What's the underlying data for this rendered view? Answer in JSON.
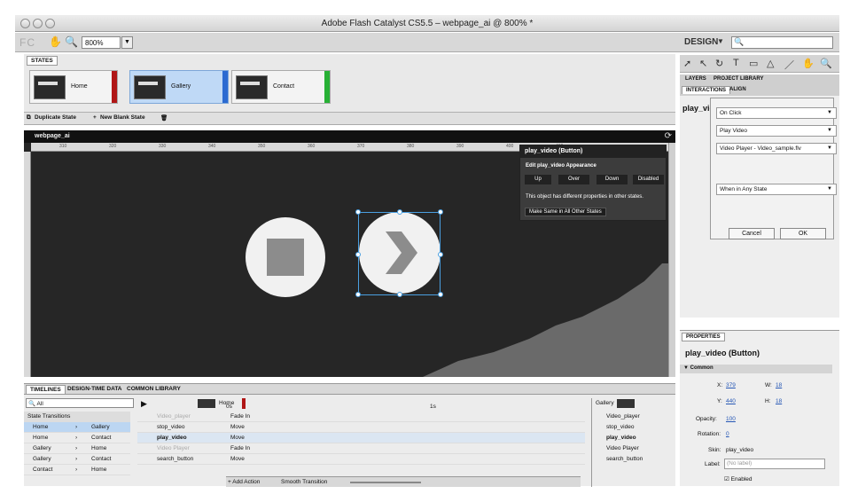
{
  "window": {
    "title": "Adobe Flash Catalyst CS5.5 – webpage_ai @ 800% *"
  },
  "appbar": {
    "logo": "FC",
    "zoom": "800%",
    "workspace": "DESIGN"
  },
  "states": {
    "tab_label": "STATES",
    "items": [
      {
        "label": "Home",
        "color": "#b01616"
      },
      {
        "label": "Gallery",
        "color": "#2b6ad1"
      },
      {
        "label": "Contact",
        "color": "#27b035"
      }
    ],
    "duplicate_label": "Duplicate State",
    "new_blank_label": "New Blank State"
  },
  "canvas": {
    "doc_name": "webpage_ai",
    "ruler_ticks": [
      "310",
      "320",
      "330",
      "340",
      "350",
      "360",
      "370",
      "380",
      "390",
      "400",
      "410"
    ]
  },
  "popup": {
    "title": "play_video (Button)",
    "subtitle": "Edit play_video Appearance",
    "buttons": [
      "Up",
      "Over",
      "Down",
      "Disabled"
    ],
    "note": "This object has different properties in other states.",
    "make_same": "Make Same in All Other States"
  },
  "timelines": {
    "tabs": [
      "TIMELINES",
      "DESIGN-TIME DATA",
      "COMMON LIBRARY"
    ],
    "filter": "All",
    "section": "State Transitions",
    "transitions": [
      {
        "from": "Home",
        "to": "Gallery"
      },
      {
        "from": "Home",
        "to": "Contact"
      },
      {
        "from": "Gallery",
        "to": "Home"
      },
      {
        "from": "Gallery",
        "to": "Contact"
      },
      {
        "from": "Contact",
        "to": "Home"
      }
    ],
    "from_state": "Home",
    "to_state": "Gallery",
    "time_0": "0s",
    "time_1": "1s",
    "objects": [
      "Video_player",
      "stop_video",
      "play_video",
      "Video Player",
      "search_button"
    ],
    "actions": [
      "Fade In",
      "Move",
      "Move",
      "Fade In",
      "Move"
    ],
    "add_action": "Add Action",
    "smooth_transition": "Smooth Transition"
  },
  "right": {
    "layers_tabs": [
      "LAYERS",
      "PROJECT LIBRARY"
    ],
    "inter_tabs": [
      "INTERACTIONS",
      "ALIGN"
    ],
    "interaction_name": "play_vic",
    "dd_event": "On Click",
    "dd_action": "Play Video",
    "dd_target": "Video Player - Video_sample.flv",
    "dd_state": "When in Any State",
    "cancel": "Cancel",
    "ok": "OK"
  },
  "props": {
    "tab": "PROPERTIES",
    "title": "play_video (Button)",
    "section": "Common",
    "x_label": "X:",
    "x": "379",
    "w_label": "W:",
    "w": "18",
    "y_label": "Y:",
    "y": "440",
    "h_label": "H:",
    "h": "18",
    "opacity_label": "Opacity:",
    "opacity": "100",
    "rotation_label": "Rotation:",
    "rotation": "0",
    "skin_label": "Skin:",
    "skin": "play_video",
    "label_label": "Label:",
    "label_placeholder": "(No label)",
    "enabled": "Enabled"
  }
}
